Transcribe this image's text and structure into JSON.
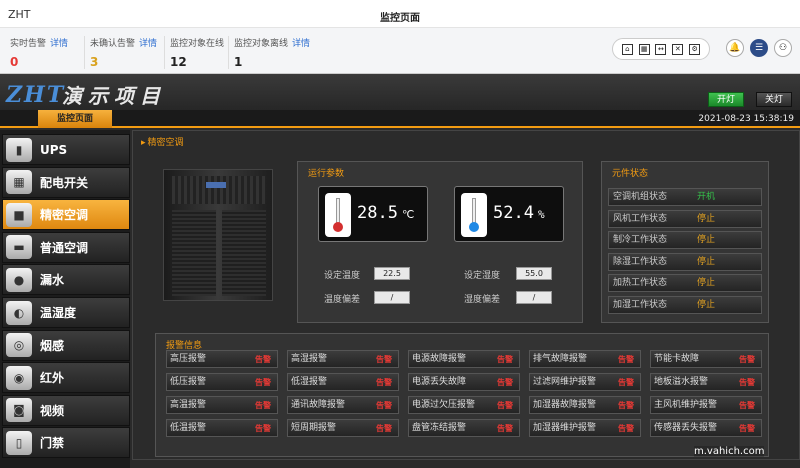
{
  "app": {
    "name": "ZHT",
    "page_title": "监控页面"
  },
  "stats": [
    {
      "label": "实时告警",
      "link": "详情",
      "value": "0",
      "color": "#e53935"
    },
    {
      "label": "未确认告警",
      "link": "详情",
      "value": "3",
      "color": "#d9a21f"
    },
    {
      "label": "监控对象在线",
      "link": "",
      "value": "12",
      "color": "#222222"
    },
    {
      "label": "监控对象离线",
      "link": "详情",
      "value": "1",
      "color": "#222222"
    }
  ],
  "toolbar": {
    "icons": [
      "home-icon",
      "grid-icon",
      "expand-icon",
      "close-icon",
      "settings-icon"
    ],
    "bell": "bell-icon",
    "menu": "list-icon",
    "network": "network-icon"
  },
  "header": {
    "logo": "ZHT",
    "project": "演示项目",
    "on_label": "开灯",
    "off_label": "关灯"
  },
  "tabs": {
    "active": "监控页面",
    "datetime": "2021-08-23 15:38:19"
  },
  "sidebar": [
    {
      "label": "UPS",
      "icon": "ups-icon",
      "glyph": "▮",
      "active": false
    },
    {
      "label": "配电开关",
      "icon": "switch-icon",
      "glyph": "▦",
      "active": false
    },
    {
      "label": "精密空调",
      "icon": "precision-ac-icon",
      "glyph": "■",
      "active": true
    },
    {
      "label": "普通空调",
      "icon": "ac-icon",
      "glyph": "▬",
      "active": false
    },
    {
      "label": "漏水",
      "icon": "water-leak-icon",
      "glyph": "●",
      "active": false
    },
    {
      "label": "温湿度",
      "icon": "temp-humidity-icon",
      "glyph": "◐",
      "active": false
    },
    {
      "label": "烟感",
      "icon": "smoke-icon",
      "glyph": "◎",
      "active": false
    },
    {
      "label": "红外",
      "icon": "infrared-icon",
      "glyph": "◉",
      "active": false
    },
    {
      "label": "视频",
      "icon": "video-icon",
      "glyph": "◙",
      "active": false
    },
    {
      "label": "门禁",
      "icon": "access-control-icon",
      "glyph": "▯",
      "active": false
    }
  ],
  "main": {
    "section_title": "精密空调",
    "params": {
      "title": "运行参数",
      "temperature": "28.5",
      "temperature_unit": "℃",
      "humidity": "52.4",
      "humidity_unit": "%",
      "set_temp_label": "设定温度",
      "set_temp": "22.5",
      "temp_dev_label": "温度偏差",
      "temp_dev": "/",
      "set_hum_label": "设定湿度",
      "set_hum": "55.0",
      "hum_dev_label": "湿度偏差",
      "hum_dev": "/"
    },
    "components": {
      "title": "元件状态",
      "rows": [
        {
          "label": "空调机组状态",
          "value": "开机",
          "color": "#35c14a"
        },
        {
          "label": "风机工作状态",
          "value": "停止",
          "color": "#e0a020"
        },
        {
          "label": "制冷工作状态",
          "value": "停止",
          "color": "#e0a020"
        },
        {
          "label": "除湿工作状态",
          "value": "停止",
          "color": "#e0a020"
        },
        {
          "label": "加热工作状态",
          "value": "停止",
          "color": "#e0a020"
        },
        {
          "label": "加湿工作状态",
          "value": "停止",
          "color": "#e0a020"
        }
      ]
    },
    "alarms": {
      "title": "报警信息",
      "flag_text": "告警",
      "columns": [
        [
          "高压报警",
          "低压报警",
          "高温报警",
          "低温报警"
        ],
        [
          "高湿报警",
          "低湿报警",
          "通讯故障报警",
          "短周期报警"
        ],
        [
          "电源故障报警",
          "电源丢失故障",
          "电源过欠压报警",
          "盘管冻结报警"
        ],
        [
          "排气故障报警",
          "过滤网维护报警",
          "加湿器故障报警",
          "加湿器维护报警"
        ],
        [
          "节能卡故障",
          "地板溢水报警",
          "主风机维护报警",
          "传感器丢失报警"
        ]
      ]
    }
  },
  "watermark": "m.vahich.com"
}
